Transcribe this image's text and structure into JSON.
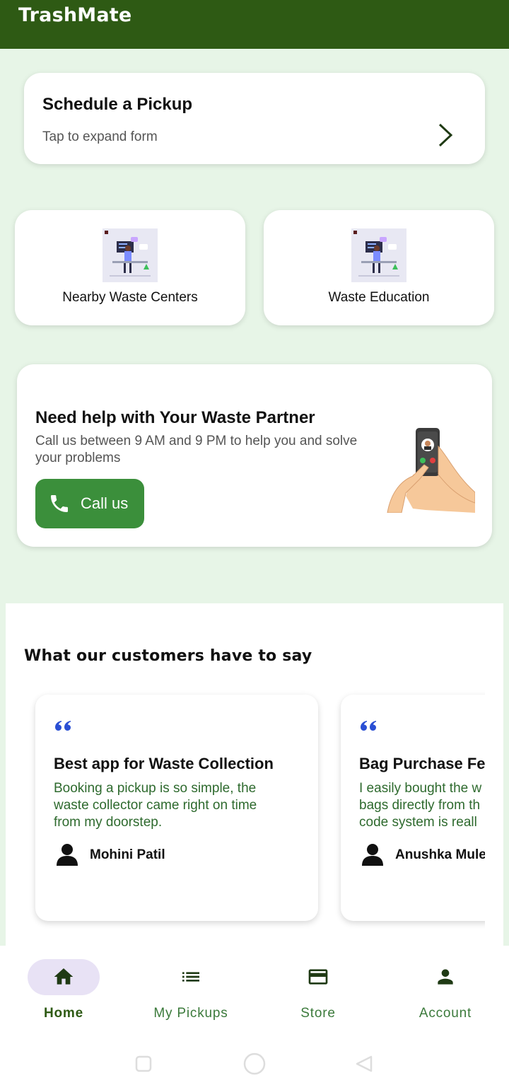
{
  "app": {
    "title": "TrashMate"
  },
  "schedule": {
    "title": "Schedule a Pickup",
    "subtitle": "Tap to expand form"
  },
  "quick_links": [
    {
      "label": "Nearby Waste Centers"
    },
    {
      "label": "Waste Education"
    }
  ],
  "help": {
    "title": "Need help with Your Waste Partner",
    "subtitle": "Call us between 9 AM and 9 PM to help you and solve your problems",
    "button_label": "Call us"
  },
  "testimonials": {
    "heading": "What our customers have to say",
    "items": [
      {
        "title": "Best app for Waste Collection",
        "body": "Booking a pickup is so simple, the\nwaste collector came right on time\nfrom my doorstep.",
        "name": "Mohini Patil"
      },
      {
        "title": "Bag Purchase Fea",
        "body": "I easily bought the w\nbags directly from th\ncode system is reall",
        "name": "Anushka Mule"
      }
    ]
  },
  "bottom_nav": [
    {
      "label": "Home",
      "icon": "home-icon",
      "active": true
    },
    {
      "label": "My Pickups",
      "icon": "list-icon",
      "active": false
    },
    {
      "label": "Store",
      "icon": "card-icon",
      "active": false
    },
    {
      "label": "Account",
      "icon": "person-icon",
      "active": false
    }
  ],
  "colors": {
    "app_bar": "#2e5a14",
    "background": "#e7f5e7",
    "call_button": "#3b8f3b",
    "testimonial_body": "#2e6a2e",
    "nav_active_pill": "#e8e2f5"
  }
}
